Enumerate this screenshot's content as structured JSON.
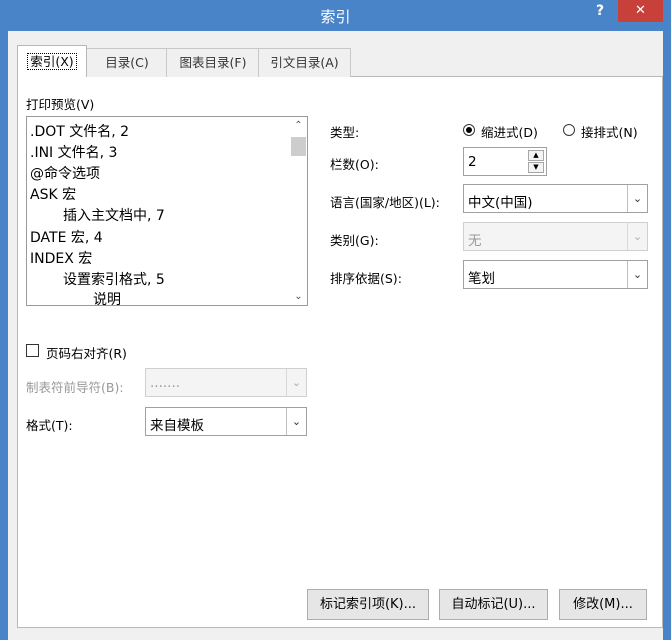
{
  "window": {
    "title": "索引",
    "help_label": "?",
    "close_label": "✕"
  },
  "tabs": [
    {
      "label": "索引(X)",
      "active": true
    },
    {
      "label": "目录(C)",
      "active": false
    },
    {
      "label": "图表目录(F)",
      "active": false
    },
    {
      "label": "引文目录(A)",
      "active": false
    }
  ],
  "preview": {
    "label": "打印预览(V)",
    "lines": [
      ".DOT  文件名, 2",
      ".INI  文件名, 3",
      "@命令选项",
      "ASK 宏",
      "插入主文档中, 7",
      "DATE 宏, 4",
      "INDEX 宏",
      "设置索引格式, 5",
      "说明"
    ]
  },
  "type": {
    "label": "类型:",
    "options": [
      {
        "label": "缩进式(D)",
        "checked": true
      },
      {
        "label": "接排式(N)",
        "checked": false
      }
    ]
  },
  "columns": {
    "label": "栏数(O):",
    "value": "2"
  },
  "language": {
    "label": "语言(国家/地区)(L):",
    "value": "中文(中国)"
  },
  "category": {
    "label": "类别(G):",
    "value": "无"
  },
  "sort": {
    "label": "排序依据(S):",
    "value": "笔划"
  },
  "right_align": {
    "label": "页码右对齐(R)",
    "checked": false
  },
  "tab_leader": {
    "label": "制表符前导符(B):",
    "value": "......."
  },
  "format": {
    "label": "格式(T):",
    "value": "来自模板"
  },
  "buttons": {
    "mark_entry": "标记索引项(K)...",
    "automark": "自动标记(U)...",
    "modify": "修改(M)..."
  },
  "colors": {
    "titlebar": "#4a84c8",
    "close": "#c7413a"
  }
}
